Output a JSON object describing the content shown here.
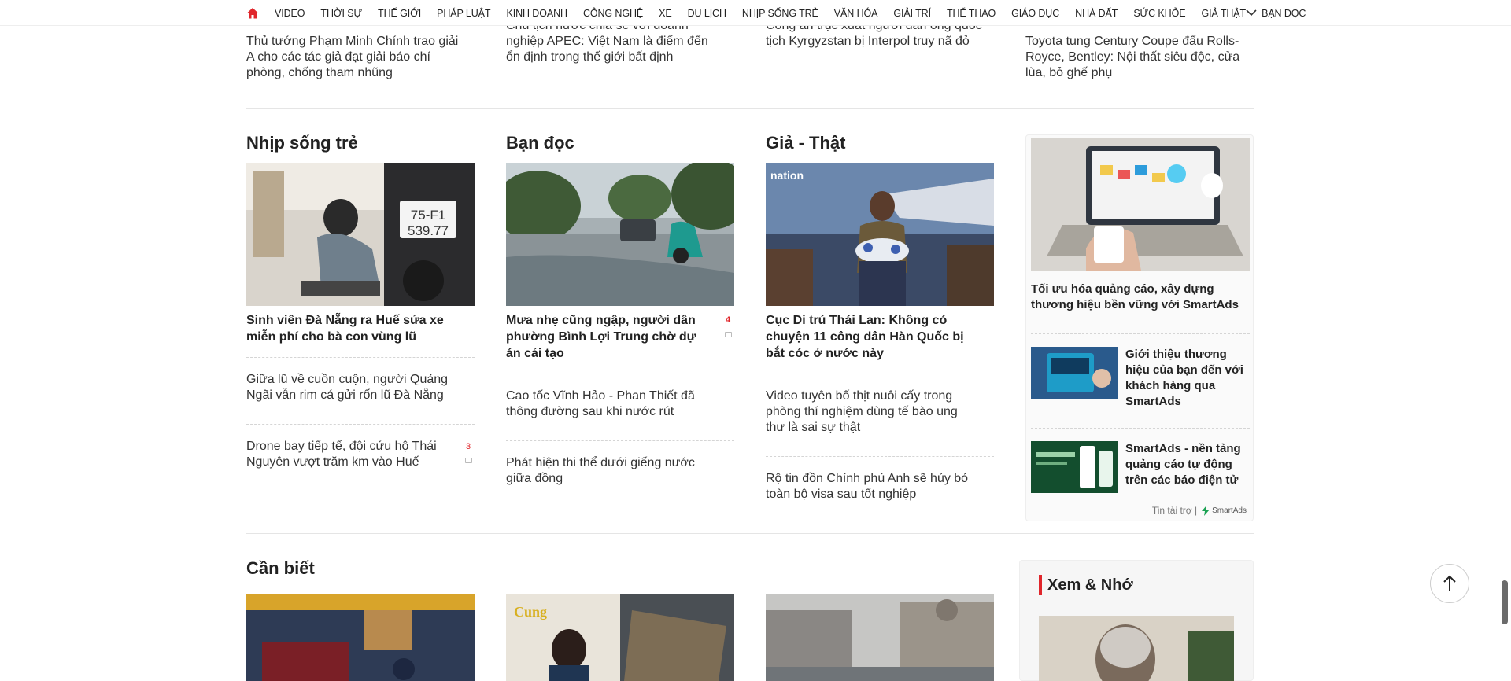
{
  "nav": {
    "items": [
      "VIDEO",
      "THỜI SỰ",
      "THẾ GIỚI",
      "PHÁP LUẬT",
      "KINH DOANH",
      "CÔNG NGHỆ",
      "XE",
      "DU LỊCH",
      "NHỊP SỐNG TRẺ",
      "VĂN HÓA",
      "GIẢI TRÍ",
      "THỂ THAO",
      "GIÁO DỤC",
      "NHÀ ĐẤT",
      "SỨC KHỎE",
      "GIẢ THẬT",
      "BẠN ĐỌC"
    ],
    "accent": "#e0262b"
  },
  "prev": {
    "col1": "Thủ tướng Phạm Minh Chính trao giải A cho các tác giả đạt giải báo chí phòng, chống tham nhũng",
    "col2": "Chủ tịch nước chia sẻ với doanh nghiệp APEC: Việt Nam là điểm đến ổn định trong thế giới bất định",
    "col3": "Công an trục xuất người đàn ông quốc tịch Kyrgyzstan bị Interpol truy nã đỏ",
    "col4": "Toyota tung Century Coupe đấu Rolls-Royce, Bentley: Nội thất siêu độc, cửa lùa, bỏ ghế phụ"
  },
  "sections": [
    {
      "title": "Nhịp sống trẻ",
      "headline": "Sinh viên Đà Nẵng ra Huế sửa xe miễn phí cho bà con vùng lũ",
      "subs": [
        {
          "text": "Giữa lũ về cuồn cuộn, người Quảng Ngãi vẫn rim cá gửi rốn lũ Đà Nẵng",
          "comments": ""
        },
        {
          "text": "Drone bay tiếp tế, đội cứu hộ Thái Nguyên vượt trăm km vào Huế",
          "comments": "3"
        }
      ]
    },
    {
      "title": "Bạn đọc",
      "headline": "Mưa nhẹ cũng ngập, người dân phường Bình Lợi Trung chờ dự án cải tạo",
      "headline_comments": "4",
      "subs": [
        {
          "text": "Cao tốc Vĩnh Hảo - Phan Thiết đã thông đường sau khi nước rút",
          "comments": ""
        },
        {
          "text": "Phát hiện thi thể dưới giếng nước giữa đồng",
          "comments": ""
        }
      ]
    },
    {
      "title": "Giả - Thật",
      "headline": "Cục Di trú Thái Lan: Không có chuyện 11 công dân Hàn Quốc bị bắt cóc ở nước này",
      "image_logo": "nation",
      "subs": [
        {
          "text": "Video tuyên bố thịt nuôi cấy trong phòng thí nghiệm dùng tế bào ung thư là sai sự thật",
          "comments": ""
        },
        {
          "text": "Rộ tin đồn Chính phủ Anh sẽ hủy bỏ toàn bộ visa sau tốt nghiệp",
          "comments": ""
        }
      ]
    }
  ],
  "ads": {
    "main_title": "Tối ưu hóa quảng cáo, xây dựng thương hiệu bền vững với SmartAds",
    "items": [
      "Giới thiệu thương hiệu của bạn đến với khách hàng qua SmartAds",
      "SmartAds - nền tảng quảng cáo tự động trên các báo điện tử"
    ],
    "footer_label": "Tin tài trợ |",
    "brand": "SmartAds"
  },
  "bottom": {
    "title": "Cần biết",
    "xem_title": "Xem & Nhớ"
  }
}
